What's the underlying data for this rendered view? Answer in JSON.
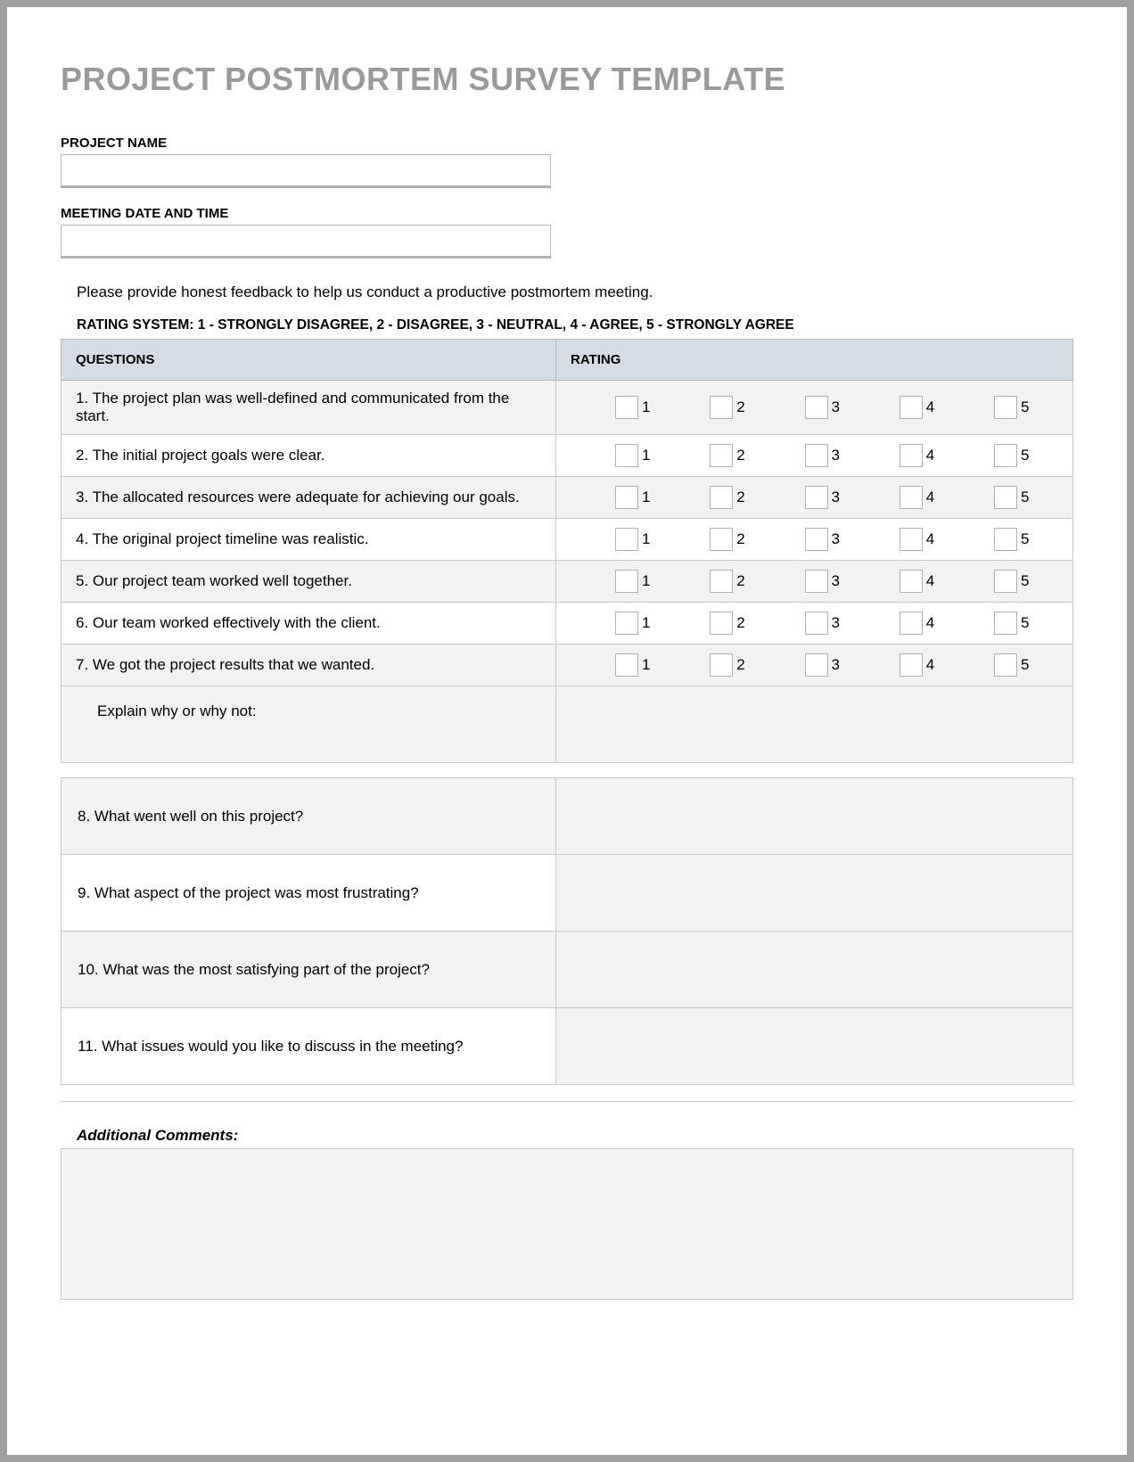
{
  "title": "PROJECT POSTMORTEM SURVEY TEMPLATE",
  "fields": {
    "project_name": {
      "label": "PROJECT NAME",
      "value": ""
    },
    "meeting_datetime": {
      "label": "MEETING DATE AND TIME",
      "value": ""
    }
  },
  "instruction": "Please provide honest feedback to help us conduct a productive postmortem meeting.",
  "rating_legend": "RATING SYSTEM: 1 - STRONGLY DISAGREE, 2 - DISAGREE, 3 - NEUTRAL, 4 - AGREE, 5 - STRONGLY AGREE",
  "headers": {
    "questions": "QUESTIONS",
    "rating": "RATING"
  },
  "rating_options": [
    "1",
    "2",
    "3",
    "4",
    "5"
  ],
  "questions": [
    "1. The project plan was well-defined and communicated from the start.",
    "2. The initial project goals were clear.",
    "3. The allocated resources were adequate for achieving our goals.",
    "4. The original project timeline was realistic.",
    "5. Our project team worked well together.",
    "6. Our team worked effectively with the client.",
    "7. We got the project results that we wanted."
  ],
  "explain_prompt": "Explain why or why not:",
  "open_questions": [
    "8. What went well on this project?",
    "9. What aspect of the project was most frustrating?",
    "10. What was the most satisfying part of the project?",
    "11. What issues would you like to discuss in the meeting?"
  ],
  "comments_label": "Additional Comments:"
}
